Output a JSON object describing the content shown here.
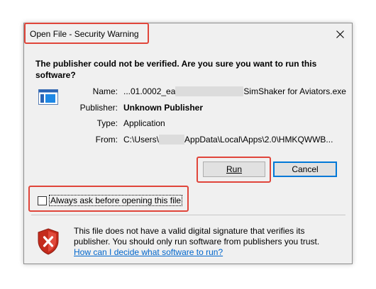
{
  "dialog": {
    "title": "Open File - Security Warning",
    "headline": "The publisher could not be verified.  Are you sure you want to run this software?",
    "fields": {
      "name_label": "Name:",
      "name_prefix": "...01.0002_ea",
      "name_suffix": "SimShaker for Aviators.exe",
      "publisher_label": "Publisher:",
      "publisher_value": "Unknown Publisher",
      "type_label": "Type:",
      "type_value": "Application",
      "from_label": "From:",
      "from_prefix": "C:\\Users\\",
      "from_suffix": "AppData\\Local\\Apps\\2.0\\HMKQWWB..."
    },
    "buttons": {
      "run_label": "Run",
      "cancel_label": "Cancel"
    },
    "checkbox": {
      "label": "Always ask before opening this file",
      "checked": false
    },
    "info": {
      "text": "This file does not have a valid digital signature that verifies its publisher.  You should only run software from publishers you trust.",
      "link": "How can I decide what software to run?"
    },
    "colors": {
      "annotation": "#e0453a",
      "accent": "#0078d7",
      "link": "#0066cc"
    },
    "icons": {
      "close": "close-icon",
      "app": "application-icon",
      "shield": "shield-warning-icon"
    }
  }
}
